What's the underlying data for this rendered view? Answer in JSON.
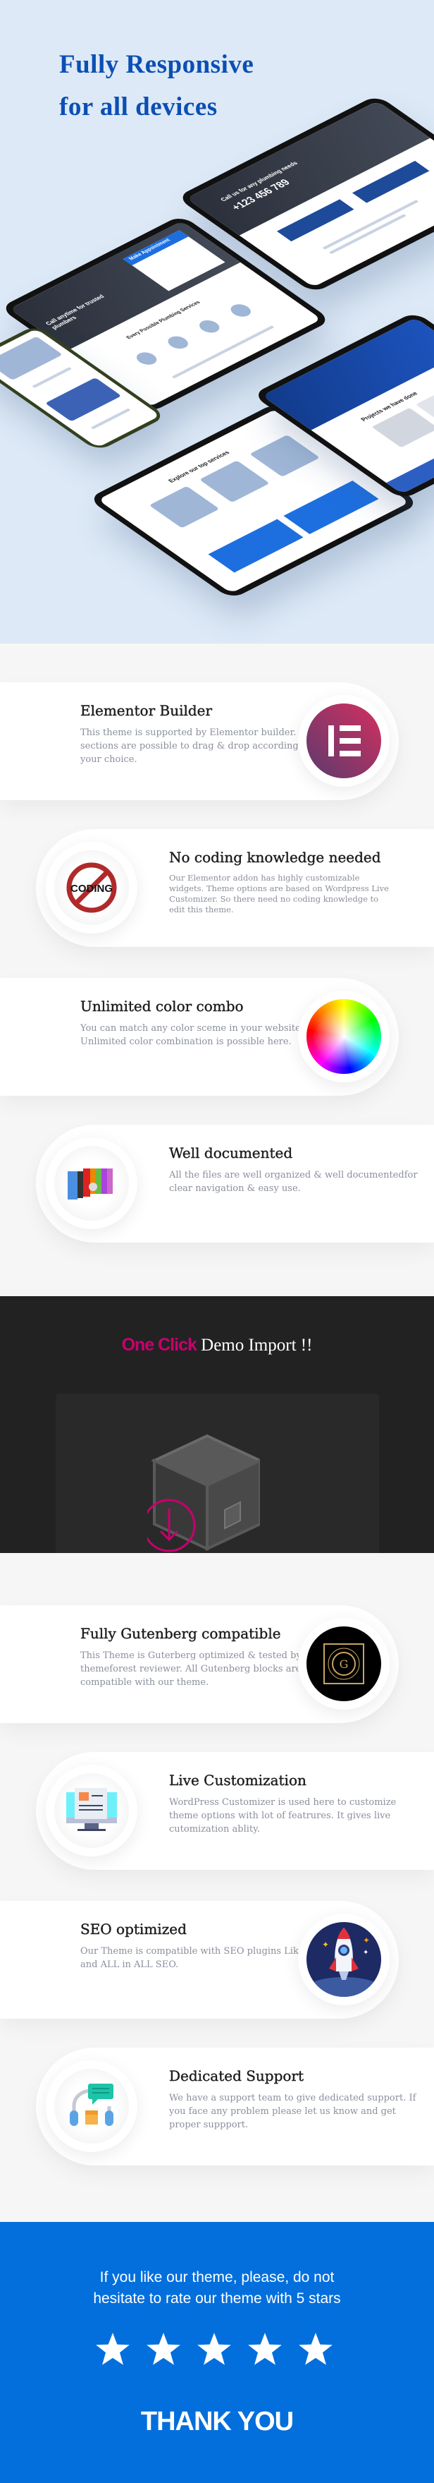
{
  "hero": {
    "title_line1": "Fully Responsive",
    "title_line2": "for all devices",
    "color": "#0b4fb4",
    "mockup_texts": [
      "Call anytime for trusted plumbers",
      "Call us for any plumbing needs",
      "+123 456 789",
      "Make Appointment",
      "Every Possible Plumbing Services",
      "Explore our top services",
      "Projects we have done"
    ]
  },
  "features_top": [
    {
      "title": "Elementor Builder",
      "text": "This theme is supported by Elementor builder. Allthe sections are possible to drag & drop according to your choice.",
      "icon": "elementor-logo-icon"
    },
    {
      "title": "No coding knowledge needed",
      "text": "Our Elementor addon has highly customizable widgets. Theme options are based on Wordpress Live Customizer. So there need no coding knowledge to edit this theme.",
      "icon": "no-coding-icon",
      "icon_text": "CODING"
    },
    {
      "title": "Unlimited color combo",
      "text": "You can match any color sceme in your website. Unlimited color combination is possible here.",
      "icon": "color-wheel-icon"
    },
    {
      "title": "Well documented",
      "text": "All the files are well organized & well documentedfor clear navigation & easy use.",
      "icon": "binders-icon"
    }
  ],
  "demo": {
    "highlight": "One Click",
    "rest": "Demo Import !!",
    "accent": "#c8006e"
  },
  "features_bottom": [
    {
      "title": "Fully Gutenberg compatible",
      "text": "This Theme is Guterberg optimized & tested by themeforest reviewer. All Gutenberg blocks are compatible with our theme.",
      "icon": "gutenberg-logo-icon"
    },
    {
      "title": "Live Customization",
      "text": "WordPress Customizer is used here to customize theme options with lot of featrures. It gives live cutomization ablity.",
      "icon": "monitor-icon"
    },
    {
      "title": "SEO optimized",
      "text": "Our Theme is compatible with SEO plugins Like Yoast and ALL in ALL SEO.",
      "icon": "rocket-icon"
    },
    {
      "title": "Dedicated Support",
      "text": "We have a support team to give dedicated support. If you face any problem please let us know and get proper suppport.",
      "icon": "headset-support-icon"
    }
  ],
  "rating": {
    "line1": "If you like our theme, please, do not",
    "line2": "hesitate to rate our theme with 5 stars",
    "stars": 5,
    "thanks": "THANK YOU",
    "bg": "#026fdd"
  }
}
